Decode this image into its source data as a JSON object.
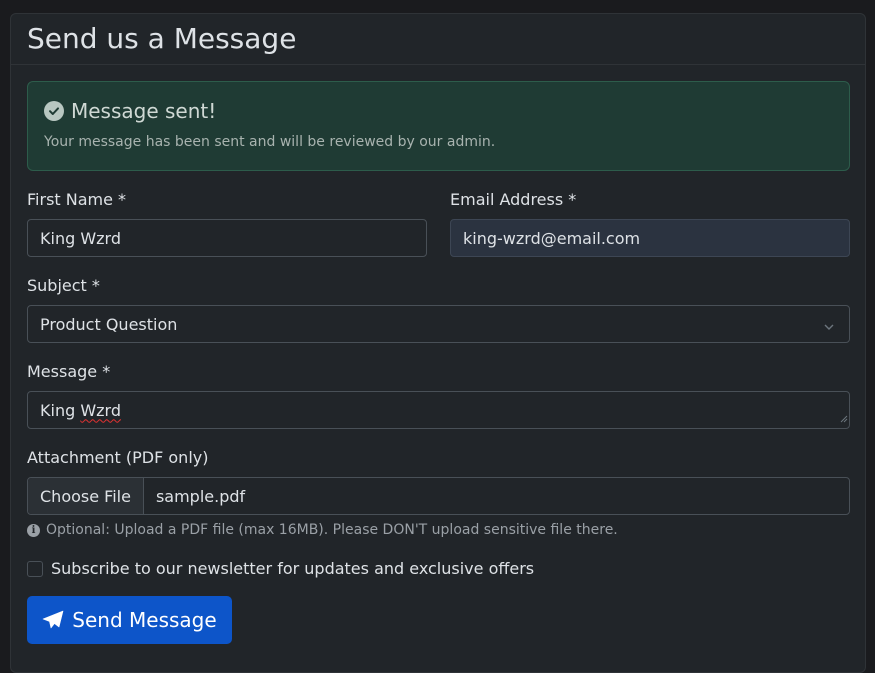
{
  "card": {
    "title": "Send us a Message"
  },
  "alert": {
    "title": "Message sent!",
    "text": "Your message has been sent and will be reviewed by our admin.",
    "icon": "check-circle-icon"
  },
  "form": {
    "first_name": {
      "label": "First Name *",
      "value": "King Wzrd"
    },
    "email": {
      "label": "Email Address *",
      "value": "king-wzrd@email.com"
    },
    "subject": {
      "label": "Subject *",
      "value": "Product Question"
    },
    "message": {
      "label": "Message *",
      "value_first": "King",
      "value_misspelled": "Wzrd"
    },
    "attachment": {
      "label": "Attachment (PDF only)",
      "button": "Choose File",
      "file": "sample.pdf",
      "help": "Optional: Upload a PDF file (max 16MB). Please DON'T upload sensitive file there."
    },
    "newsletter": {
      "label": "Subscribe to our newsletter for updates and exclusive offers"
    },
    "submit": {
      "label": "Send Message",
      "icon": "paper-plane-icon"
    }
  },
  "colors": {
    "background": "#1a1b1e",
    "card": "#212529",
    "alert_bg": "#1f3b34",
    "primary": "#0d55c9",
    "autofill_bg": "#2b3340"
  }
}
